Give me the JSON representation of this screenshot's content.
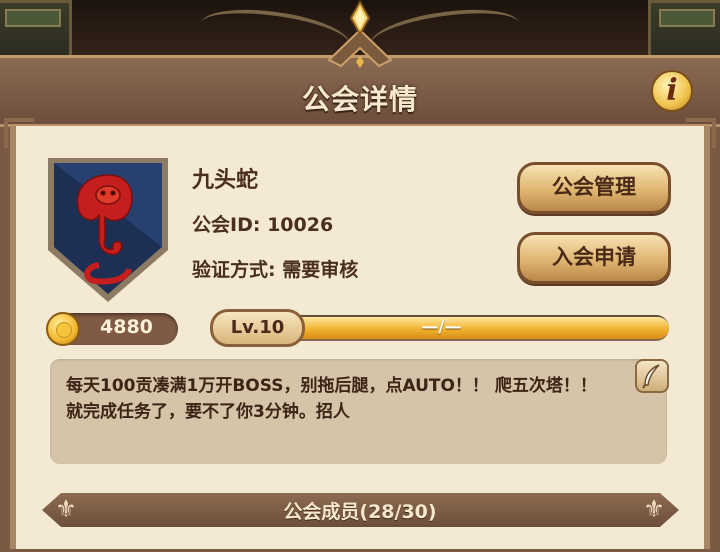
{
  "header": {
    "title": "公会详情",
    "info_label": "i"
  },
  "guild": {
    "name": "九头蛇",
    "id_label": "公会ID:",
    "id_value": "10026",
    "verify_label": "验证方式:",
    "verify_value": "需要审核",
    "coins": "4880",
    "level_label": "Lv.10",
    "level_progress_text": "—/—",
    "level_progress_fraction": 1.0
  },
  "buttons": {
    "manage": "公会管理",
    "apply": "入会申请"
  },
  "notice": {
    "text": "每天100贡凑满1万开BOSS，别拖后腿，点AUTO！！ 爬五次塔！！就完成任务了，要不了你3分钟。招人"
  },
  "members": {
    "title": "公会成员(28/30)"
  },
  "colors": {
    "panel_bg": "#f4e9d3",
    "shield_blue": "#1e2f54",
    "snake_red": "#c41e1e",
    "gold": "#f0b42e"
  }
}
